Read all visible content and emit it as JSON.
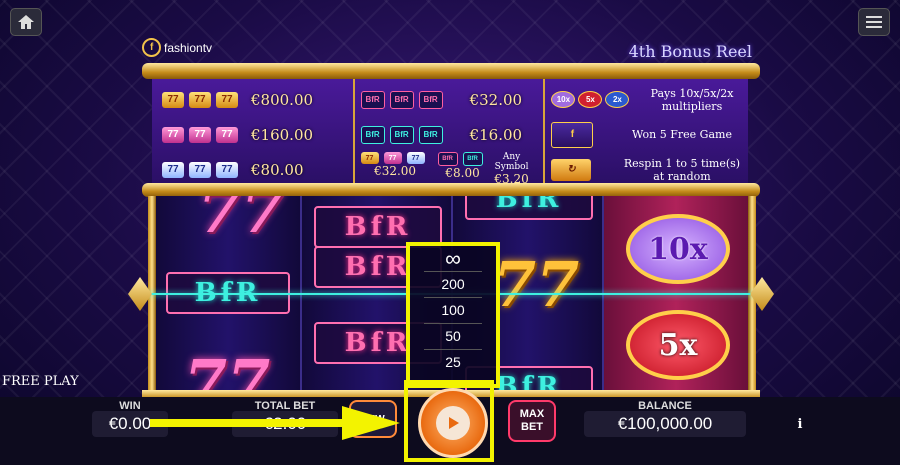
{
  "logo_text": "fashiontv",
  "logo_mark": "f",
  "bonus_title": "4th Bonus Reel",
  "paytable": {
    "sevens": [
      {
        "icon": "gold-seven",
        "color": "gold",
        "payout": "€800.00"
      },
      {
        "icon": "pink-seven",
        "color": "pink",
        "payout": "€160.00"
      },
      {
        "icon": "white-seven",
        "color": "white",
        "payout": "€80.00"
      }
    ],
    "bfr": [
      {
        "icon": "pink-bfr",
        "payout": "€32.00"
      },
      {
        "icon": "cyan-bfr",
        "payout": "€16.00"
      }
    ],
    "mixed": {
      "left_payout": "€32.00",
      "mid_payout": "€8.00",
      "any_label": "Any Symbol",
      "any_payout": "€3.20"
    },
    "info": [
      {
        "badges": [
          "10x",
          "5x",
          "2x"
        ],
        "text": "Pays 10x/5x/2x multipliers"
      },
      {
        "text": "Won 5 Free Game"
      },
      {
        "text": "Respin 1 to 5 time(s) at random"
      }
    ]
  },
  "reels": {
    "bfr_text": "BfR",
    "seven": "7",
    "mult_10": "10x",
    "mult_5": "5x"
  },
  "bet_options": [
    "∞",
    "200",
    "100",
    "50",
    "25"
  ],
  "free_play_label": "FREE PLAY",
  "win": {
    "label": "WIN",
    "value": "€0.00"
  },
  "total_bet": {
    "label": "TOTAL BET",
    "value": "€2.00"
  },
  "new_label": "NEW",
  "max_bet_label": "MAX BET",
  "balance": {
    "label": "BALANCE",
    "value": "€100,000.00"
  },
  "info_symbol": "i",
  "colors": {
    "highlight": "#f3f300",
    "frame_gold": "#c48b19",
    "spin_orange": "#e96a10"
  },
  "icons": [
    "home-icon",
    "menu-icon",
    "play-icon",
    "info-icon",
    "arrow-right-icon",
    "infinity-icon"
  ]
}
